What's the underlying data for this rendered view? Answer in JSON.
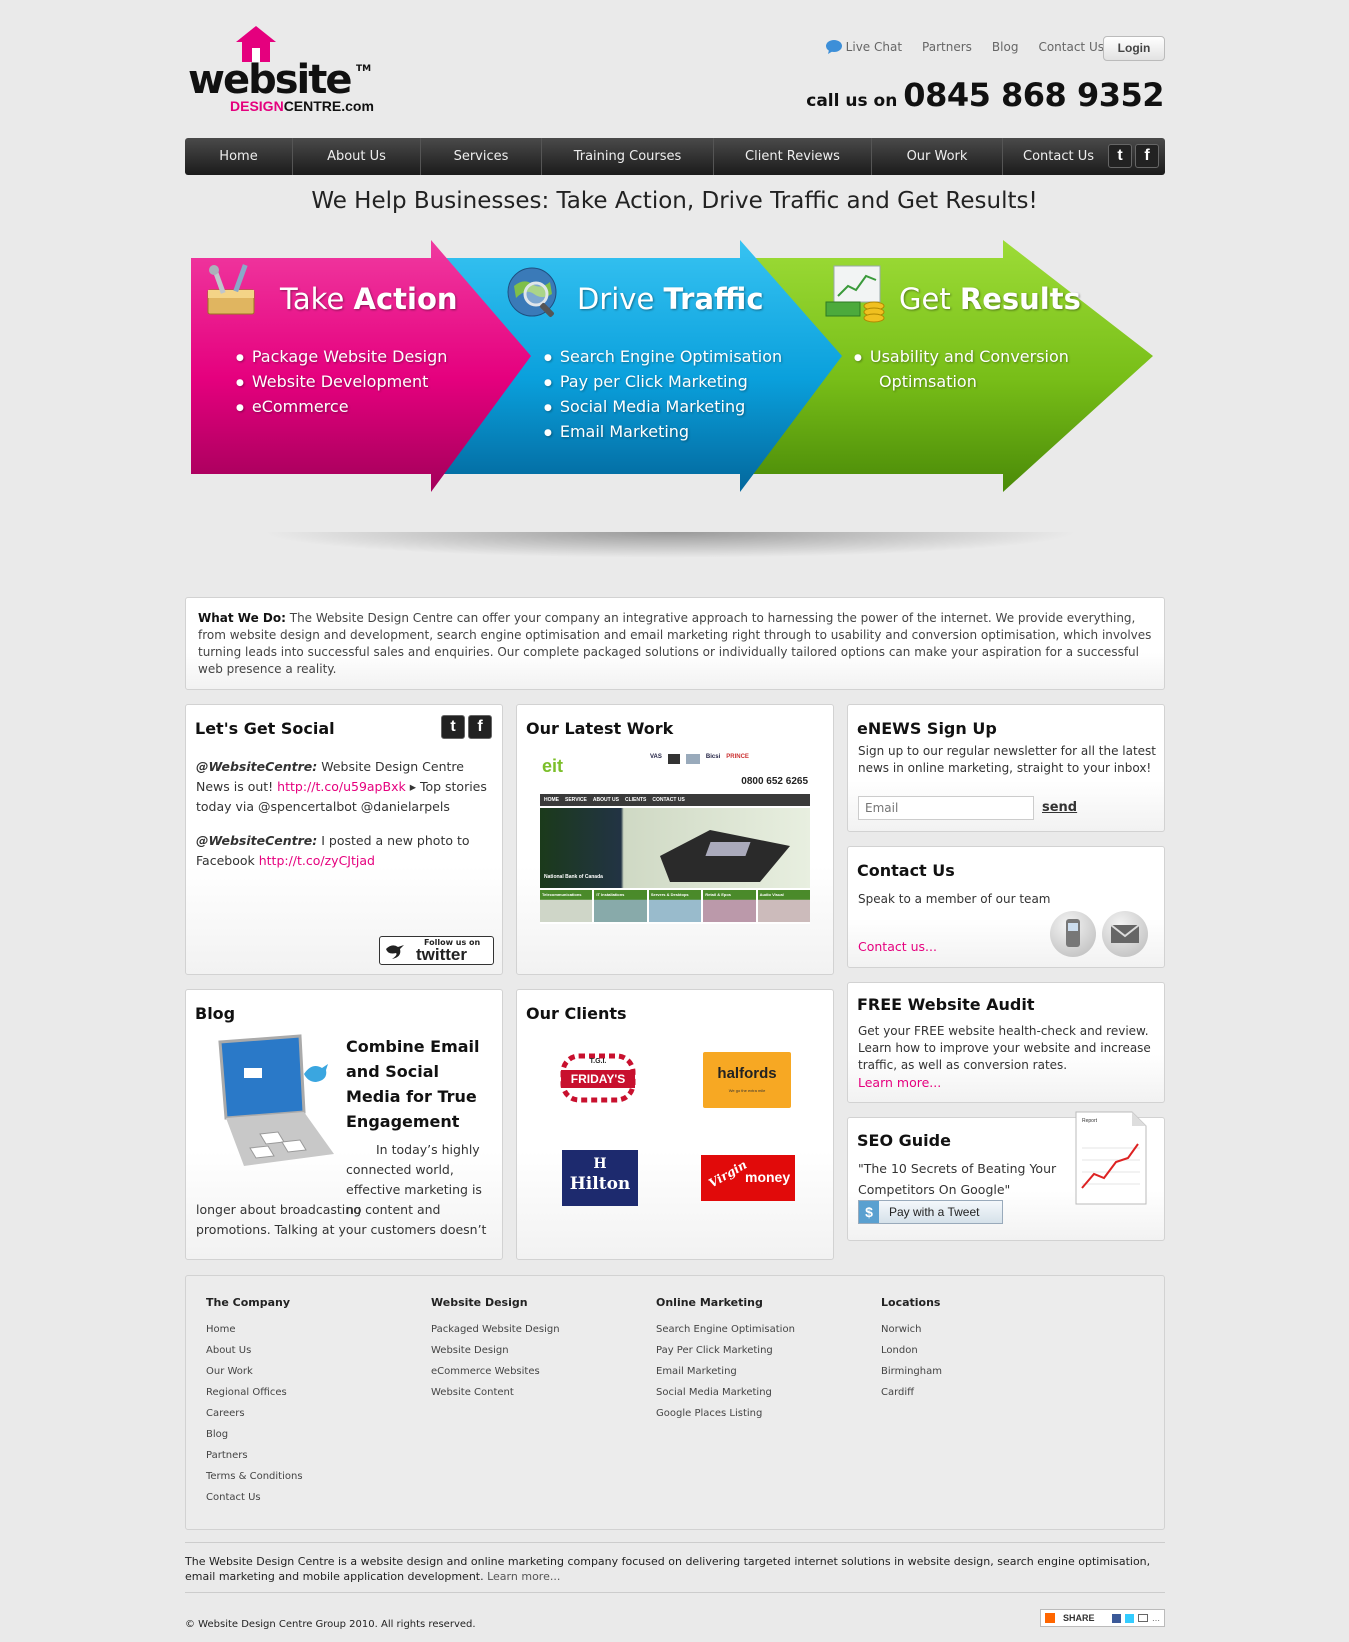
{
  "brand": {
    "logo_main": "website",
    "logo_tm": "TM",
    "logo_sub_pink": "DESIGN",
    "logo_sub_rest": "CENTRE.com"
  },
  "topnav": {
    "live_chat": "Live Chat",
    "partners": "Partners",
    "blog": "Blog",
    "contact": "Contact Us",
    "login": "Login"
  },
  "callus": {
    "label": "call us on",
    "number": "0845 868 9352"
  },
  "mainnav": [
    "Home",
    "About Us",
    "Services",
    "Training Courses",
    "Client Reviews",
    "Our Work",
    "Contact Us"
  ],
  "tagline": "We Help Businesses: Take Action, Drive Traffic and Get Results!",
  "banner": {
    "action": {
      "t1": "Take ",
      "t2": "Action",
      "items": [
        "Package Website Design",
        "Website Development",
        "eCommerce"
      ]
    },
    "traffic": {
      "t1": "Drive ",
      "t2": "Traffic",
      "items": [
        "Search Engine Optimisation",
        "Pay per Click Marketing",
        "Social Media Marketing",
        "Email Marketing"
      ]
    },
    "results": {
      "t1": "Get ",
      "t2": "Results",
      "items": [
        "Usability and Conversion",
        "Optimsation"
      ]
    }
  },
  "whatwedo": {
    "label": "What We Do:",
    "text": " The Website Design Centre can offer your company an integrative approach to harnessing the power of the internet. We provide everything, from website design and development, search engine optimisation and email marketing right through to usability and conversion optimisation, which involves turning leads into successful sales and enquiries. Our complete packaged solutions or individually tailored options can make your aspiration for a successful web presence a reality."
  },
  "social": {
    "title": "Let's Get Social",
    "t1_user": "@WebsiteCentre:",
    "t1_a": " Website Design Centre News is out! ",
    "t1_link": "http://t.co/u59apBxk",
    "t1_b": " ▸ Top stories today via @spencertalbot @danielarpels",
    "t2_user": "@WebsiteCentre:",
    "t2_a": " I posted a new photo to Facebook ",
    "t2_link": "http://t.co/zyCJtjad",
    "follow_small": "Follow us on",
    "follow_big": "twitter"
  },
  "latestwork": {
    "title": "Our Latest Work",
    "mock_logo": "eit",
    "mock_phone": "0800 652 6265",
    "mock_nav": [
      "HOME",
      "SERVICE",
      "ABOUT US",
      "CLIENTS",
      "CONTACT US"
    ],
    "mock_tabs": [
      "Telecommunications",
      "IT Installations",
      "Servers & Desktops",
      "Retail & Epos",
      "Audio Visual"
    ],
    "mock_client": "National Bank of Canada",
    "mock_partners": [
      "VAS",
      "",
      "",
      "Bicsi",
      "PRINCE"
    ]
  },
  "enews": {
    "title": "eNEWS Sign Up",
    "text": "Sign up to our regular newsletter for all the latest news in online marketing, straight to your inbox!",
    "placeholder": "Email",
    "send": "send"
  },
  "contact": {
    "title": "Contact Us",
    "text": "Speak to a member of our team",
    "link": "Contact us..."
  },
  "blog": {
    "title": "Blog",
    "headline": "Combine Email and Social Media for True Engagement",
    "body_a": "In today’s highly connected world, effective marketing is no",
    "body_b": "longer about broadcasting content and promotions. Talking at your customers doesn’t"
  },
  "clients": {
    "title": "Our Clients",
    "fridays_small": "T.G.I.",
    "fridays": "FRIDAY'S",
    "halfords": "halfords",
    "halfords_tag": "We go the extra mile",
    "hilton": "Hilton",
    "virgin": "Virgin",
    "money": "money"
  },
  "audit": {
    "title": "FREE Website Audit",
    "text": "Get your FREE website health-check and review. Learn how to improve your website and increase traffic, as well as conversion rates.",
    "link": "Learn more..."
  },
  "seo": {
    "title": "SEO Guide",
    "text": "\"The 10 Secrets of Beating Your Competitors On Google\"",
    "button": "Pay with a Tweet",
    "report": "Report"
  },
  "footer": {
    "company": {
      "title": "The Company",
      "items": [
        "Home",
        "About Us",
        "Our Work",
        "Regional Offices",
        "Careers",
        "Blog",
        "Partners",
        "Terms & Conditions",
        "Contact Us"
      ]
    },
    "design": {
      "title": "Website Design",
      "items": [
        "Packaged Website Design",
        "Website Design",
        "eCommerce Websites",
        "Website Content"
      ]
    },
    "marketing": {
      "title": "Online Marketing",
      "items": [
        "Search Engine Optimisation",
        "Pay Per Click Marketing",
        "Email Marketing",
        "Social Media Marketing",
        "Google Places Listing"
      ]
    },
    "locations": {
      "title": "Locations",
      "items": [
        "Norwich",
        "London",
        "Birmingham",
        "Cardiff"
      ]
    }
  },
  "about_text": "The Website Design Centre is a website design and online marketing company focused on delivering targeted internet solutions in website design, search engine optimisation, email marketing and mobile application development. ",
  "about_link": "Learn more...",
  "copyright": "© Website Design Centre Group 2010. All rights reserved.",
  "share": "SHARE",
  "colors": {
    "pink": "#e5007e",
    "blue": "#12a8e0",
    "green": "#7cc21a",
    "nav": "#2a2a2a"
  }
}
